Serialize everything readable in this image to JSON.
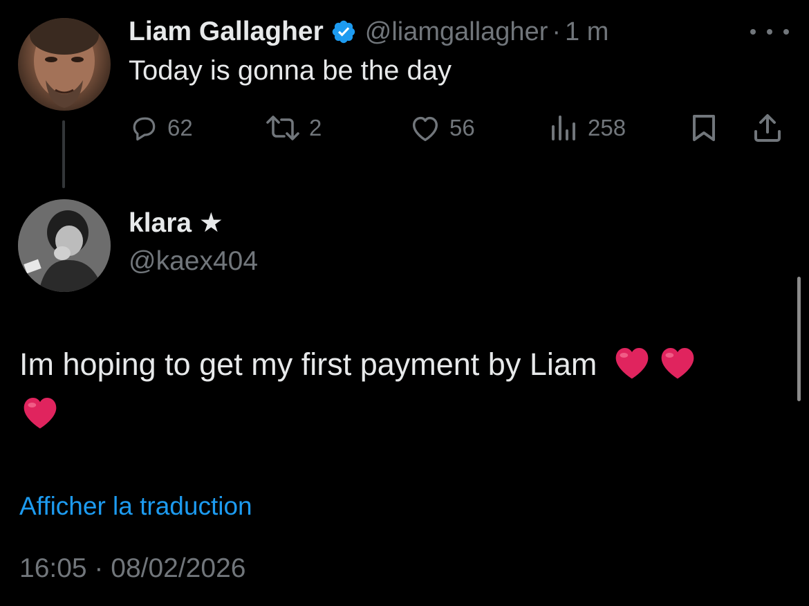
{
  "parent_tweet": {
    "author_name": "Liam Gallagher",
    "verified": true,
    "handle": "@liamgallagher",
    "separator": "·",
    "time_ago": "1 m",
    "text": "Today is gonna be the day",
    "actions": {
      "replies": "62",
      "retweets": "2",
      "likes": "56",
      "views": "258"
    },
    "icons": {
      "more": "more-horizontal-icon",
      "reply": "speech-bubble-icon",
      "retweet": "retweet-icon",
      "like": "heart-outline-icon",
      "views": "bar-chart-icon",
      "bookmark": "bookmark-icon",
      "share": "share-upload-icon",
      "verified": "verified-badge-icon"
    }
  },
  "reply_tweet": {
    "author_name": "klara ★",
    "handle": "@kaex404",
    "text": "Im hoping to get my first payment by Liam",
    "emoji_hearts": [
      "❤️",
      "❤️",
      "❤️"
    ],
    "translate_label": "Afficher la traduction",
    "timestamp": "16:05 · 08/02/2026"
  },
  "colors": {
    "background": "#000000",
    "primary_text": "#e7e9ea",
    "secondary_text": "#71767b",
    "accent_link": "#1d9bf0",
    "verified_badge": "#1d9bf0",
    "heart_red": "#e0245e"
  }
}
